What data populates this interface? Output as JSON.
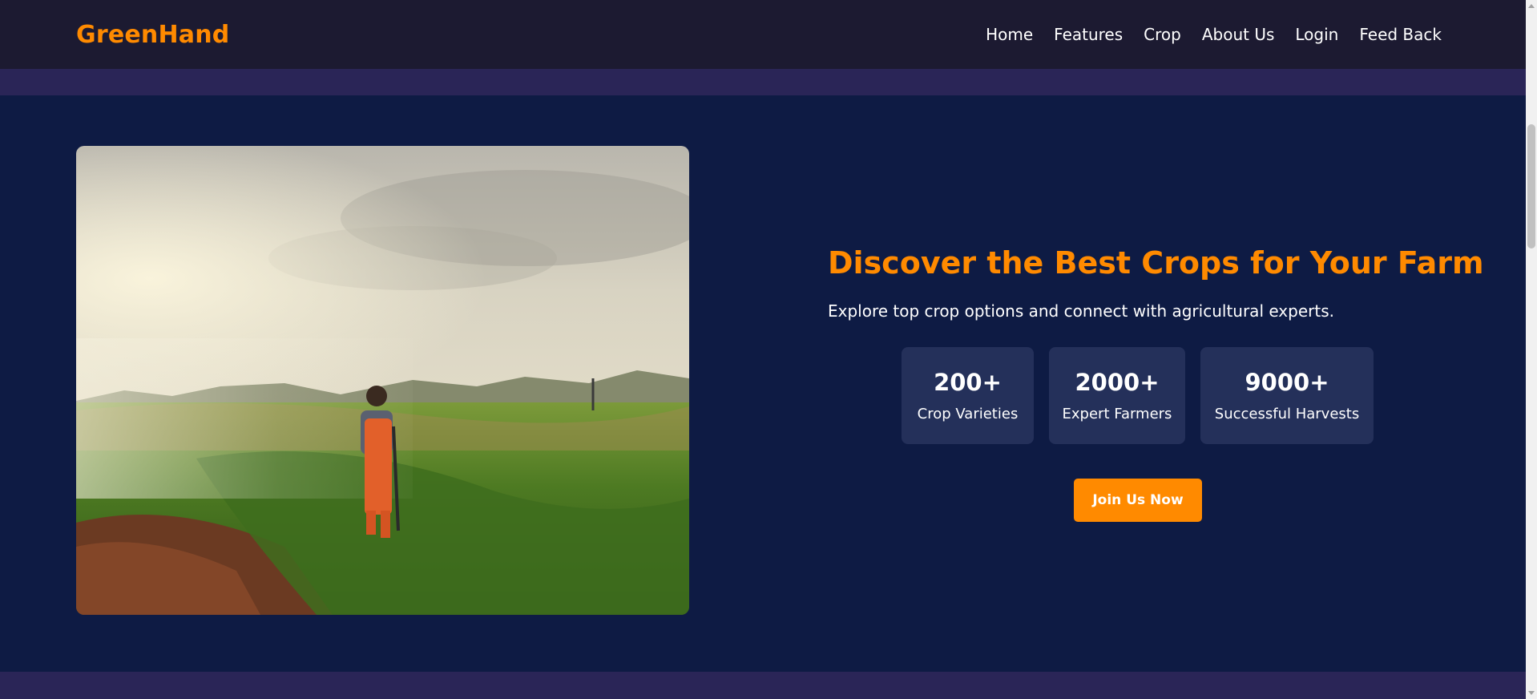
{
  "brand": "GreenHand",
  "nav": {
    "items": [
      "Home",
      "Features",
      "Crop",
      "About Us",
      "Login",
      "Feed Back"
    ]
  },
  "hero": {
    "image_alt": "Farmer working in a green crop field with sprinklers",
    "headline": "Discover the Best Crops for Your Farm",
    "subtitle": "Explore top crop options and connect with agricultural experts.",
    "stats": [
      {
        "value": "200+",
        "label": "Crop Varieties"
      },
      {
        "value": "2000+",
        "label": "Expert Farmers"
      },
      {
        "value": "9000+",
        "label": "Successful Harvests"
      }
    ],
    "cta_label": "Join Us Now"
  },
  "colors": {
    "accent": "#ff8a00",
    "navbar_bg": "#1c1a31",
    "page_bg": "#0e1b44",
    "band_bg": "#2a2557",
    "stat_card_bg": "#24305a"
  }
}
